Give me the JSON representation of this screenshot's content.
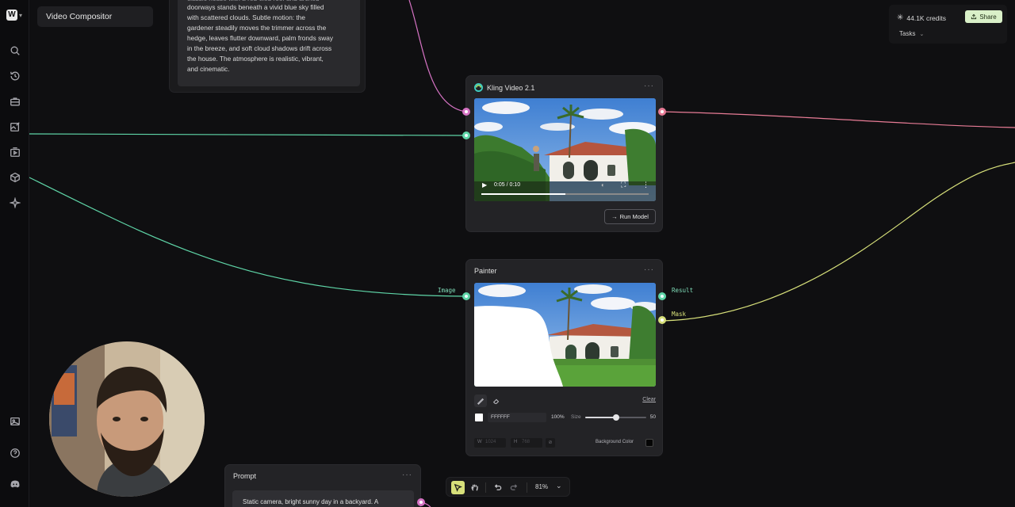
{
  "app": {
    "project_title": "Video Compositor"
  },
  "top_right": {
    "credits": "44.1K credits",
    "share_label": "Share",
    "tasks_label": "Tasks"
  },
  "rail": {
    "icons": [
      "search-icon",
      "history-icon",
      "briefcase-icon",
      "edit-image-icon",
      "video-icon",
      "cube-icon",
      "sparkle-icon",
      "gallery-icon",
      "help-icon",
      "discord-icon"
    ]
  },
  "text_node": {
    "lines": [
      "doorways stands beneath a vivid blue sky filled",
      "with scattered clouds. Subtle motion: the",
      "gardener steadily moves the trimmer across the",
      "hedge, leaves flutter downward, palm fronds sway",
      "in the breeze, and soft cloud shadows drift across",
      "the house. The atmosphere is realistic, vibrant,",
      "and cinematic."
    ]
  },
  "kling_node": {
    "title": "Kling Video 2.1",
    "time": "0:05 / 0:10",
    "progress": 0.5,
    "run_label": "Run Model"
  },
  "painter_node": {
    "title": "Painter",
    "input_label": "Image",
    "output_result": "Result",
    "output_mask": "Mask",
    "clear_label": "Clear",
    "color_hex": "FFFFFF",
    "opacity": "100%",
    "size_label": "Size",
    "size_value": "50",
    "size_fraction": 0.5,
    "width_label": "W",
    "width_placeholder": "1024",
    "height_label": "H",
    "height_placeholder": "768",
    "bg_color_label": "Background Color"
  },
  "prompt_node": {
    "title": "Prompt",
    "text": "Static camera, bright sunny day in a backyard. A"
  },
  "toolbar": {
    "zoom": "81%"
  },
  "colors": {
    "pink_wire": "#d673c4",
    "teal_wire": "#5fd6a8",
    "yellow_wire": "#d7e07a",
    "rose_wire": "#e87c96",
    "share_bg": "#d9f0c8"
  }
}
